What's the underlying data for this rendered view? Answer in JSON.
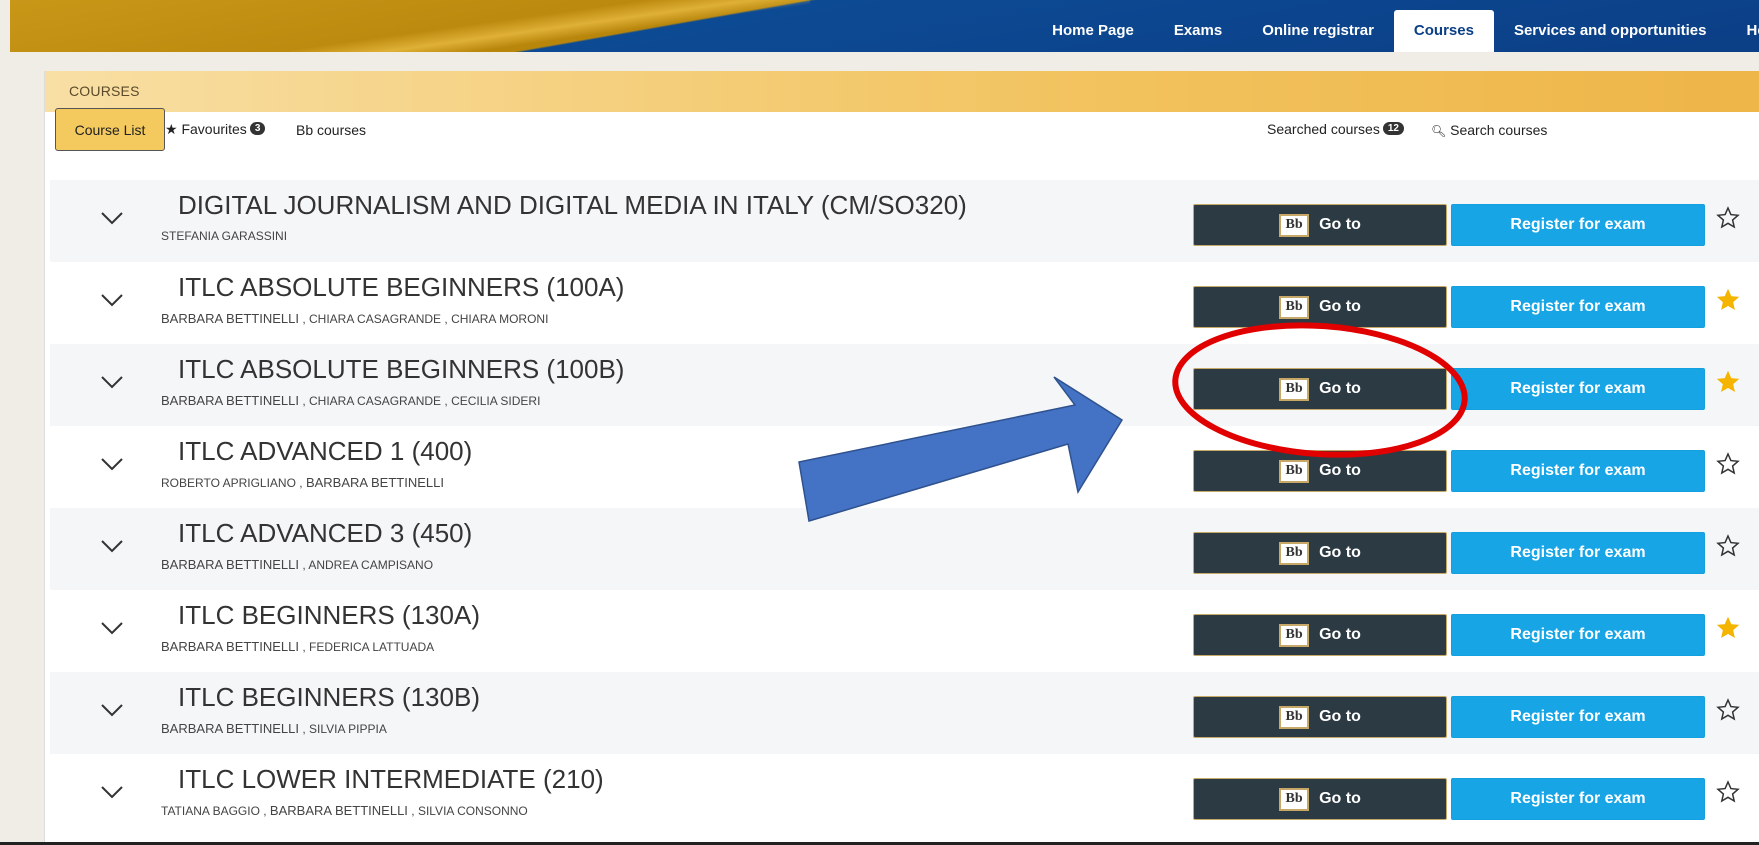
{
  "nav": {
    "items": [
      "Home Page",
      "Exams",
      "Online registrar",
      "Courses",
      "Services and opportunities",
      "Help"
    ],
    "active_index": 3
  },
  "panel": {
    "title": "COURSES",
    "tabs": {
      "course_list": "Course List",
      "favourites": "Favourites",
      "favourites_count": "3",
      "bb_courses": "Bb courses",
      "searched_courses": "Searched courses",
      "searched_count": "12",
      "search_courses": "Search courses"
    }
  },
  "buttons": {
    "goto_label": "Go to",
    "bb_logo": "Bb",
    "register_label": "Register for exam"
  },
  "courses": [
    {
      "title": "DIGITAL JOURNALISM AND DIGITAL MEDIA IN ITALY (CM/SO320)",
      "teachers": [
        {
          "name": "STEFANIA GARASSINI",
          "size": "small"
        }
      ],
      "favourite": false
    },
    {
      "title": "ITLC ABSOLUTE BEGINNERS (100A)",
      "teachers": [
        {
          "name": "BARBARA BETTINELLI",
          "size": "big"
        },
        {
          "name": "CHIARA CASAGRANDE",
          "size": "small"
        },
        {
          "name": "CHIARA MORONI",
          "size": "small"
        }
      ],
      "favourite": true
    },
    {
      "title": "ITLC ABSOLUTE BEGINNERS (100B)",
      "teachers": [
        {
          "name": "BARBARA BETTINELLI",
          "size": "big"
        },
        {
          "name": "CHIARA CASAGRANDE",
          "size": "small"
        },
        {
          "name": "CECILIA SIDERI",
          "size": "small"
        }
      ],
      "favourite": true
    },
    {
      "title": "ITLC ADVANCED 1 (400)",
      "teachers": [
        {
          "name": "ROBERTO APRIGLIANO",
          "size": "small"
        },
        {
          "name": "BARBARA BETTINELLI",
          "size": "big"
        }
      ],
      "favourite": false
    },
    {
      "title": "ITLC ADVANCED 3 (450)",
      "teachers": [
        {
          "name": "BARBARA BETTINELLI",
          "size": "big"
        },
        {
          "name": "ANDREA CAMPISANO",
          "size": "small"
        }
      ],
      "favourite": false
    },
    {
      "title": "ITLC BEGINNERS (130A)",
      "teachers": [
        {
          "name": "BARBARA BETTINELLI",
          "size": "big"
        },
        {
          "name": "FEDERICA LATTUADA",
          "size": "small"
        }
      ],
      "favourite": true
    },
    {
      "title": "ITLC BEGINNERS (130B)",
      "teachers": [
        {
          "name": "BARBARA BETTINELLI",
          "size": "big"
        },
        {
          "name": "SILVIA PIPPIA",
          "size": "small"
        }
      ],
      "favourite": false
    },
    {
      "title": "ITLC LOWER INTERMEDIATE (210)",
      "teachers": [
        {
          "name": "TATIANA BAGGIO",
          "size": "small"
        },
        {
          "name": "BARBARA BETTINELLI",
          "size": "big"
        },
        {
          "name": "SILVIA CONSONNO",
          "size": "small"
        }
      ],
      "favourite": false
    }
  ],
  "colors": {
    "star_filled": "#f5b400",
    "annotation_ellipse": "#e00000",
    "annotation_arrow": "#4472c4"
  }
}
